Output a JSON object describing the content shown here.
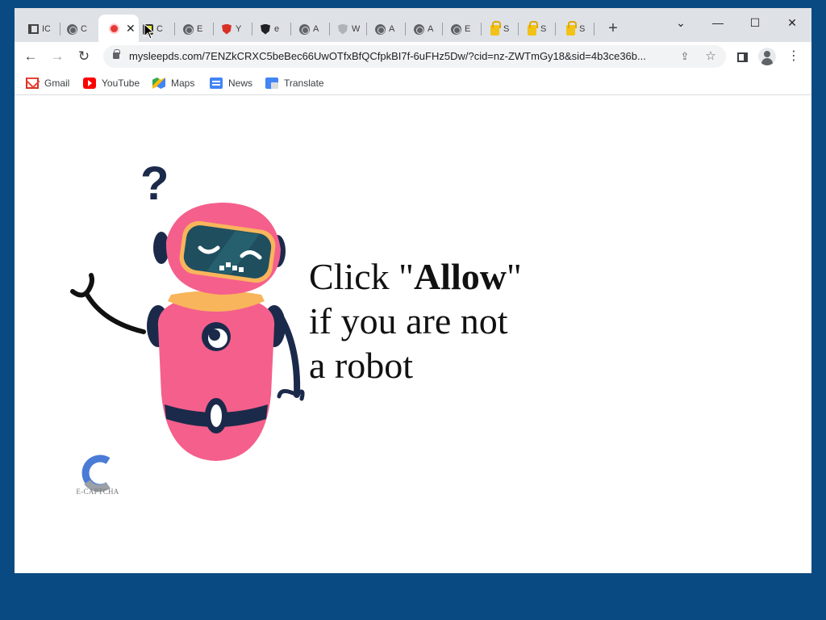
{
  "browser": {
    "tabs": [
      {
        "label": "IC",
        "icon": "stack-icon"
      },
      {
        "label": "C",
        "icon": "globe-icon"
      },
      {
        "label": "",
        "icon": "red-circle-icon",
        "active": true,
        "close": "✕"
      },
      {
        "label": "C",
        "icon": "yellow-shield-icon"
      },
      {
        "label": "E",
        "icon": "globe-icon"
      },
      {
        "label": "Y",
        "icon": "red-shield-icon"
      },
      {
        "label": "e",
        "icon": "black-shield-icon"
      },
      {
        "label": "A",
        "icon": "globe-icon"
      },
      {
        "label": "W",
        "icon": "gray-shield-icon"
      },
      {
        "label": "A",
        "icon": "globe-icon"
      },
      {
        "label": "A",
        "icon": "globe-icon"
      },
      {
        "label": "E",
        "icon": "globe-icon"
      },
      {
        "label": "S",
        "icon": "lock-icon"
      },
      {
        "label": "S",
        "icon": "lock-icon"
      },
      {
        "label": "S",
        "icon": "lock-icon"
      }
    ],
    "new_tab": "+",
    "window_controls": {
      "tabsearch": "⌄",
      "minimize": "—",
      "maximize": "☐",
      "close": "✕"
    },
    "nav": {
      "back": "←",
      "forward": "→",
      "reload": "↻"
    },
    "url": "mysleepds.com/7ENZkCRXC5beBec66UwOTfxBfQCfpkBI7f-6uFHz5Dw/?cid=nz-ZWTmGy18&sid=4b3ce36b...",
    "star": "☆",
    "share": "⇪",
    "menu": "⋮"
  },
  "bookmarks": [
    {
      "label": "Gmail",
      "icon": "gmail-icon"
    },
    {
      "label": "YouTube",
      "icon": "youtube-icon"
    },
    {
      "label": "Maps",
      "icon": "maps-icon"
    },
    {
      "label": "News",
      "icon": "news-icon"
    },
    {
      "label": "Translate",
      "icon": "translate-icon"
    }
  ],
  "page": {
    "headline_line1_prefix": "Click \"",
    "headline_bold": "Allow",
    "headline_line1_suffix": "\"",
    "headline_line2": "if you are not",
    "headline_line3": "a robot",
    "captcha_logo_letter": "C",
    "captcha_label": "E-CAPTCHA",
    "question_mark": "?"
  },
  "colors": {
    "desktop_bg": "#0a4a82",
    "robot_pink": "#f55f8c",
    "robot_navy": "#1b2a4a",
    "visor_teal": "#1f4f5f",
    "collar_orange": "#f9b55c"
  }
}
